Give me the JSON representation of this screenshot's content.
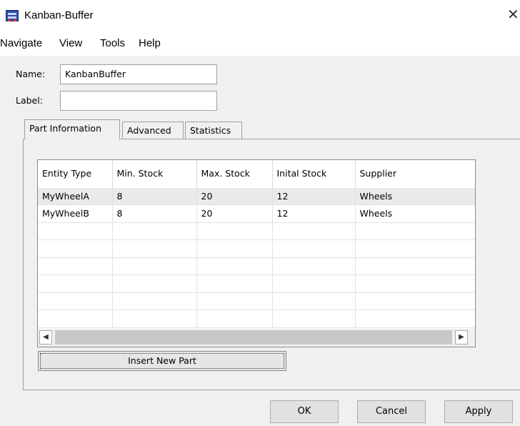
{
  "window": {
    "title": "Kanban-Buffer",
    "close_glyph": "✕"
  },
  "menu": {
    "items": [
      "Navigate",
      "View",
      "Tools",
      "Help"
    ]
  },
  "form": {
    "name_label": "Name:",
    "name_value": "KanbanBuffer",
    "label_label": "Label:",
    "label_value": ""
  },
  "tabs": [
    {
      "label": "Part Information",
      "active": true
    },
    {
      "label": "Advanced",
      "active": false
    },
    {
      "label": "Statistics",
      "active": false
    }
  ],
  "table": {
    "columns": [
      "Entity Type",
      "Min. Stock",
      "Max. Stock",
      "Inital Stock",
      "Supplier"
    ],
    "rows": [
      [
        "MyWheelA",
        "8",
        "20",
        "12",
        "Wheels"
      ],
      [
        "MyWheelB",
        "8",
        "20",
        "12",
        "Wheels"
      ]
    ]
  },
  "scroll": {
    "left_glyph": "◀",
    "right_glyph": "▶"
  },
  "buttons": {
    "insert_new_part": "Insert New Part",
    "ok": "OK",
    "cancel": "Cancel",
    "apply": "Apply"
  }
}
